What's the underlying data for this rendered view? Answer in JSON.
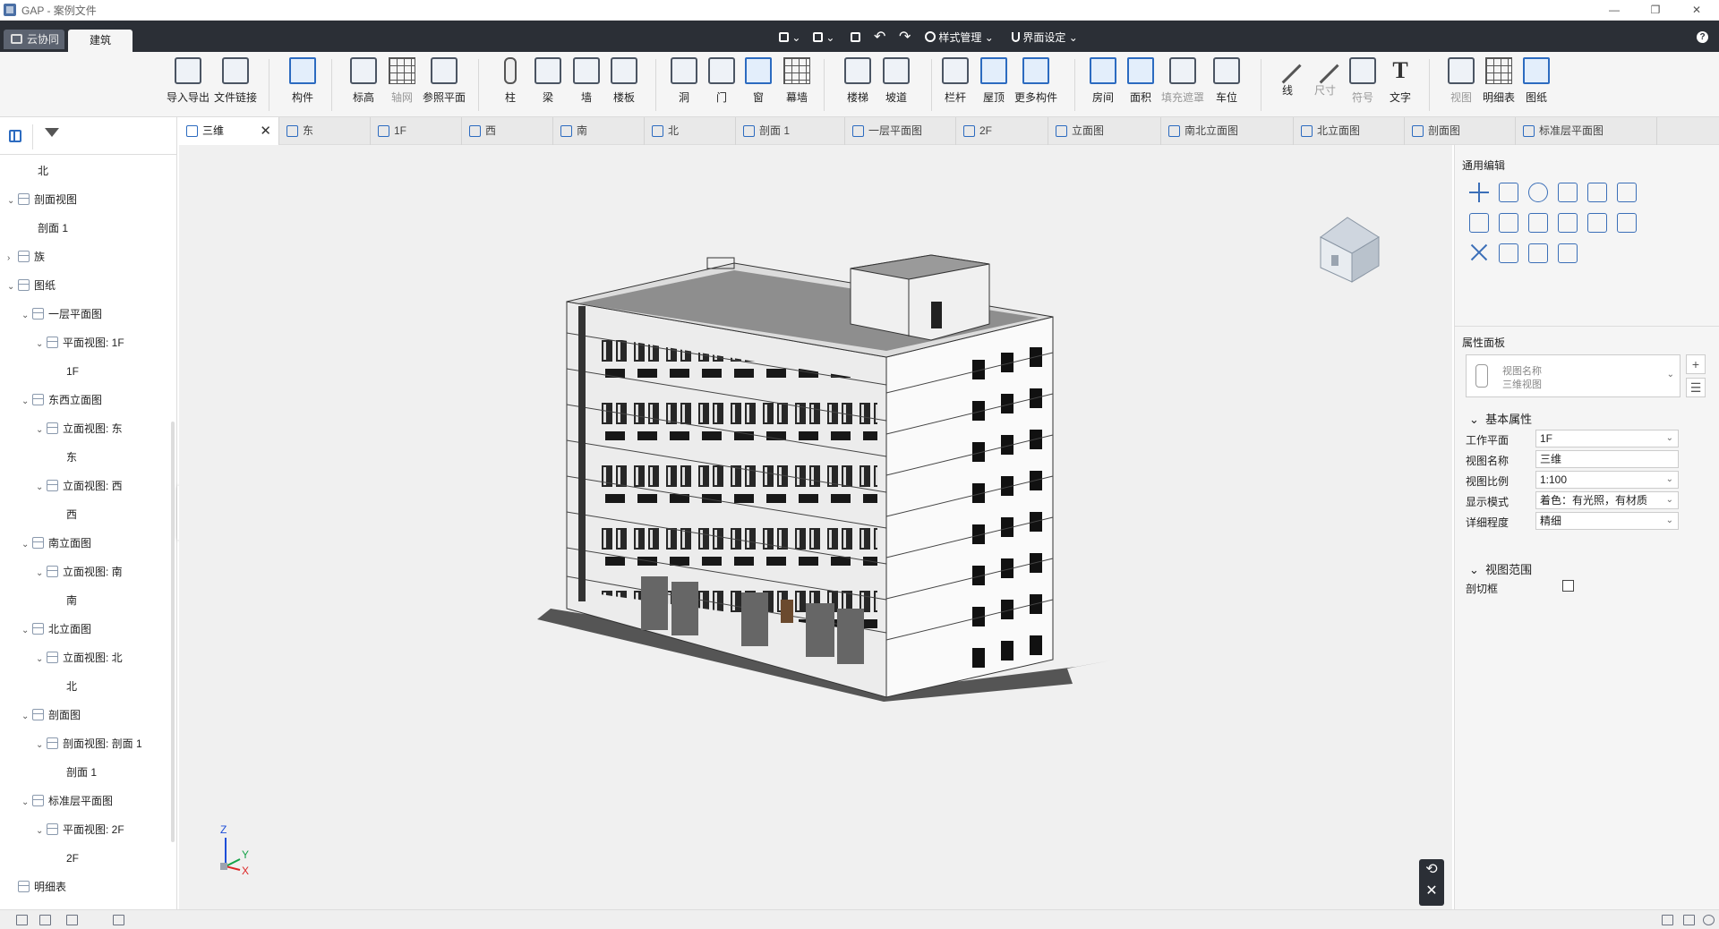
{
  "window": {
    "title": "GAP - 案例文件",
    "minimize": "—",
    "restore": "❐",
    "close": "✕"
  },
  "menubar": {
    "cloud_tab": "云协同",
    "active_tab": "建筑",
    "quick_tools": [
      {
        "label": "",
        "caret": "⌄"
      },
      {
        "label": "",
        "caret": "⌄"
      }
    ],
    "undo": "↶",
    "redo": "↷",
    "style_mgmt": "样式管理",
    "ui_settings": "界面设定",
    "help": "?"
  },
  "ribbon": [
    {
      "id": "import-export",
      "label": "导入导出",
      "icon": "cad-import-icon",
      "dim": false
    },
    {
      "id": "file-link",
      "label": "文件链接",
      "icon": "file-link-icon",
      "dim": false
    },
    {
      "id": "component",
      "label": "构件",
      "icon": "component-icon",
      "dim": false
    },
    {
      "id": "elevation-mark",
      "label": "标高",
      "icon": "level-icon",
      "dim": false
    },
    {
      "id": "grid",
      "label": "轴网",
      "icon": "grid-icon",
      "dim": true
    },
    {
      "id": "ref-plane",
      "label": "参照平面",
      "icon": "reference-plane-icon",
      "dim": false
    },
    {
      "id": "column",
      "label": "柱",
      "icon": "column-icon",
      "dim": false
    },
    {
      "id": "beam",
      "label": "梁",
      "icon": "beam-icon",
      "dim": false
    },
    {
      "id": "wall",
      "label": "墙",
      "icon": "wall-icon",
      "dim": false
    },
    {
      "id": "slab",
      "label": "楼板",
      "icon": "slab-icon",
      "dim": false
    },
    {
      "id": "opening",
      "label": "洞",
      "icon": "opening-icon",
      "dim": false
    },
    {
      "id": "door",
      "label": "门",
      "icon": "door-icon",
      "dim": false
    },
    {
      "id": "window",
      "label": "窗",
      "icon": "window-icon",
      "dim": false
    },
    {
      "id": "curtain-wall",
      "label": "幕墙",
      "icon": "curtain-wall-icon",
      "dim": false
    },
    {
      "id": "stair",
      "label": "楼梯",
      "icon": "stair-icon",
      "dim": false
    },
    {
      "id": "ramp",
      "label": "坡道",
      "icon": "ramp-icon",
      "dim": false
    },
    {
      "id": "railing",
      "label": "栏杆",
      "icon": "railing-icon",
      "dim": false
    },
    {
      "id": "roof",
      "label": "屋顶",
      "icon": "roof-icon",
      "dim": false
    },
    {
      "id": "more",
      "label": "更多构件",
      "icon": "more-components-icon",
      "dim": false
    },
    {
      "id": "room",
      "label": "房间",
      "icon": "room-icon",
      "dim": false
    },
    {
      "id": "area",
      "label": "面积",
      "icon": "area-icon",
      "dim": false
    },
    {
      "id": "fill-mask",
      "label": "填充遮罩",
      "icon": "fill-mask-icon",
      "dim": true
    },
    {
      "id": "parking",
      "label": "车位",
      "icon": "parking-icon",
      "dim": false
    },
    {
      "id": "line",
      "label": "线",
      "icon": "line-icon",
      "dim": false
    },
    {
      "id": "dimension",
      "label": "尺寸",
      "icon": "dimension-icon",
      "dim": true
    },
    {
      "id": "symbol",
      "label": "符号",
      "icon": "symbol-icon",
      "dim": true
    },
    {
      "id": "text",
      "label": "文字",
      "icon": "text-icon",
      "dim": false
    },
    {
      "id": "view",
      "label": "视图",
      "icon": "view-icon",
      "dim": true
    },
    {
      "id": "schedule",
      "label": "明细表",
      "icon": "schedule-icon",
      "dim": false
    },
    {
      "id": "sheet",
      "label": "图纸",
      "icon": "sheet-icon",
      "dim": false
    }
  ],
  "tree": [
    {
      "label": "北",
      "depth": 1,
      "twisty": ""
    },
    {
      "label": "剖面视图",
      "depth": 0,
      "twisty": "⌄",
      "icon": true
    },
    {
      "label": "剖面 1",
      "depth": 1,
      "twisty": ""
    },
    {
      "label": "族",
      "depth": 0,
      "twisty": "›",
      "icon": true
    },
    {
      "label": "图纸",
      "depth": 0,
      "twisty": "⌄",
      "icon": true
    },
    {
      "label": "一层平面图",
      "depth": 1,
      "twisty": "⌄",
      "icon": true
    },
    {
      "label": "平面视图: 1F",
      "depth": 2,
      "twisty": "⌄",
      "icon": true
    },
    {
      "label": "1F",
      "depth": 3,
      "twisty": ""
    },
    {
      "label": "东西立面图",
      "depth": 1,
      "twisty": "⌄",
      "icon": true
    },
    {
      "label": "立面视图: 东",
      "depth": 2,
      "twisty": "⌄",
      "icon": true
    },
    {
      "label": "东",
      "depth": 3,
      "twisty": ""
    },
    {
      "label": "立面视图: 西",
      "depth": 2,
      "twisty": "⌄",
      "icon": true
    },
    {
      "label": "西",
      "depth": 3,
      "twisty": ""
    },
    {
      "label": "南立面图",
      "depth": 1,
      "twisty": "⌄",
      "icon": true
    },
    {
      "label": "立面视图: 南",
      "depth": 2,
      "twisty": "⌄",
      "icon": true
    },
    {
      "label": "南",
      "depth": 3,
      "twisty": ""
    },
    {
      "label": "北立面图",
      "depth": 1,
      "twisty": "⌄",
      "icon": true
    },
    {
      "label": "立面视图: 北",
      "depth": 2,
      "twisty": "⌄",
      "icon": true
    },
    {
      "label": "北",
      "depth": 3,
      "twisty": ""
    },
    {
      "label": "剖面图",
      "depth": 1,
      "twisty": "⌄",
      "icon": true
    },
    {
      "label": "剖面视图: 剖面 1",
      "depth": 2,
      "twisty": "⌄",
      "icon": true
    },
    {
      "label": "剖面 1",
      "depth": 3,
      "twisty": ""
    },
    {
      "label": "标准层平面图",
      "depth": 1,
      "twisty": "⌄",
      "icon": true
    },
    {
      "label": "平面视图: 2F",
      "depth": 2,
      "twisty": "⌄",
      "icon": true
    },
    {
      "label": "2F",
      "depth": 3,
      "twisty": ""
    },
    {
      "label": "明细表",
      "depth": 0,
      "twisty": "",
      "icon": true
    }
  ],
  "view_tabs": [
    {
      "label": "三维",
      "active": true,
      "closable": true
    },
    {
      "label": "东"
    },
    {
      "label": "1F"
    },
    {
      "label": "西"
    },
    {
      "label": "南"
    },
    {
      "label": "北"
    },
    {
      "label": "剖面 1"
    },
    {
      "label": "一层平面图"
    },
    {
      "label": "2F"
    },
    {
      "label": "立面图"
    },
    {
      "label": "南北立面图"
    },
    {
      "label": "北立面图"
    },
    {
      "label": "剖面图"
    },
    {
      "label": "标准层平面图"
    }
  ],
  "canvas": {
    "axis": {
      "z": "Z",
      "y": "Y",
      "x": "X"
    },
    "close_buttons": {
      "restore": "⟲",
      "close": "✕"
    }
  },
  "right_panel": {
    "general_edit_title": "通用编辑",
    "tools": [
      "move-icon",
      "copy-icon",
      "rotate-icon",
      "align-icon",
      "split-icon",
      "offset-icon",
      "copy2-icon",
      "stack-icon",
      "trim-icon",
      "scale-icon",
      "array-icon",
      "mirror-icon",
      "delete-icon",
      "3d-box-icon",
      "paint-icon",
      "measure-icon"
    ],
    "property_panel_title": "属性面板",
    "view_name_label": "视图名称",
    "view_name_value": "三维视图",
    "add_btn": "+",
    "list_btn": "☰",
    "basic_section": "基本属性",
    "props": [
      {
        "label": "工作平面",
        "value": "1F",
        "dropdown": true
      },
      {
        "label": "视图名称",
        "value": "三维",
        "dropdown": false
      },
      {
        "label": "视图比例",
        "value": "1:100",
        "dropdown": true
      },
      {
        "label": "显示模式",
        "value": "着色：有光照，有材质",
        "dropdown": true
      },
      {
        "label": "详细程度",
        "value": "精细",
        "dropdown": true
      }
    ],
    "range_section": "视图范围",
    "clip_label": "剖切框",
    "clip_checked": false
  },
  "colors": {
    "dark": "#2b2f36",
    "accent": "#2c6bc0"
  }
}
